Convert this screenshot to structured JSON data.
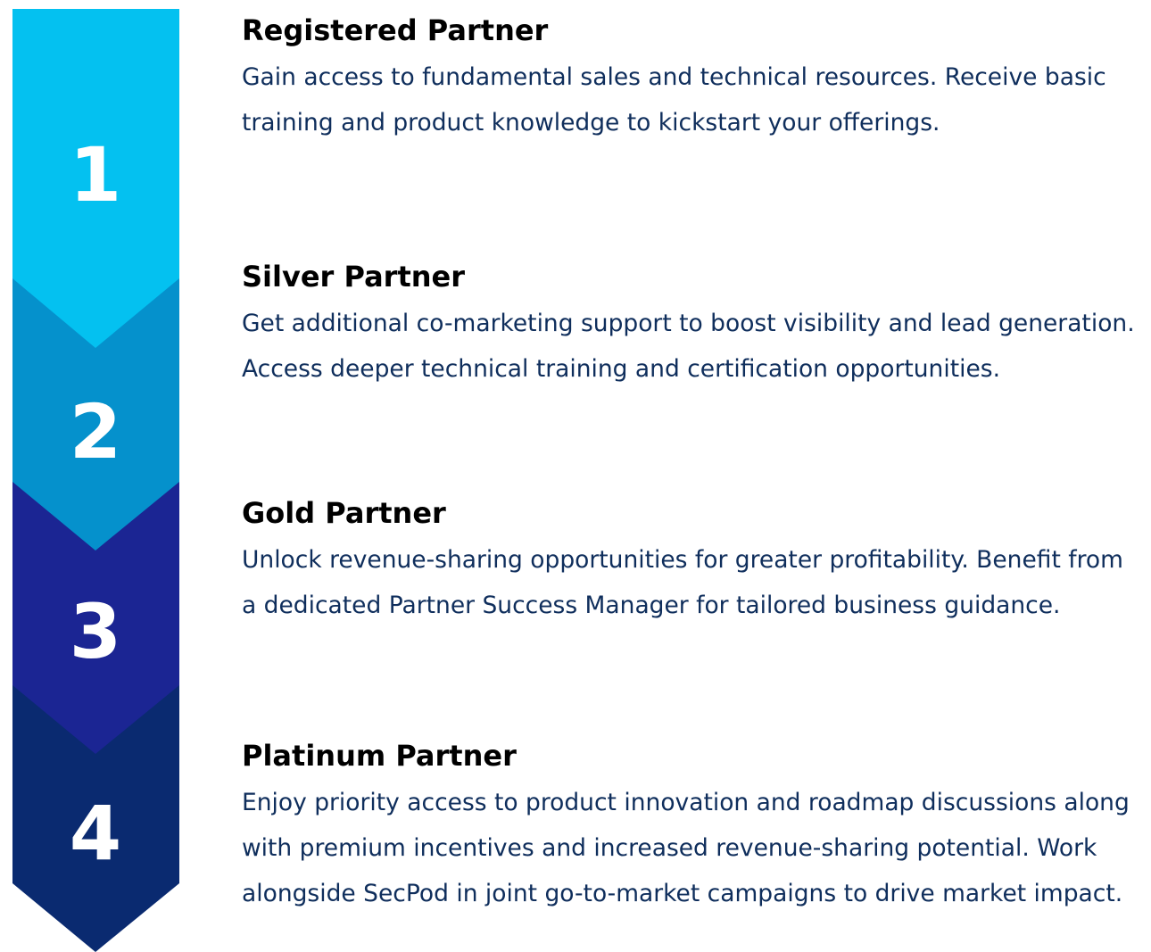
{
  "colors": {
    "tier1": "#04c1f0",
    "tier2": "#0591cc",
    "tier3": "#1b2593",
    "tier4": "#0a2a70",
    "title_text": "#000000",
    "body_text": "#0f2e5c"
  },
  "tiers": [
    {
      "number": "1",
      "title": "Registered Partner",
      "description": "Gain access to fundamental sales and technical resources. Receive basic training and product knowledge to kickstart your offerings."
    },
    {
      "number": "2",
      "title": "Silver Partner",
      "description": "Get additional co-marketing support to boost visibility and lead generation. Access deeper technical training and certification opportunities."
    },
    {
      "number": "3",
      "title": "Gold Partner",
      "description": "Unlock revenue-sharing opportunities for greater profitability. Benefit from a dedicated Partner Success Manager for tailored business guidance."
    },
    {
      "number": "4",
      "title": "Platinum Partner",
      "description": "Enjoy priority access to product innovation and roadmap discussions along with premium incentives and increased revenue-sharing potential. Work alongside SecPod in joint go-to-market campaigns to drive market impact."
    }
  ]
}
